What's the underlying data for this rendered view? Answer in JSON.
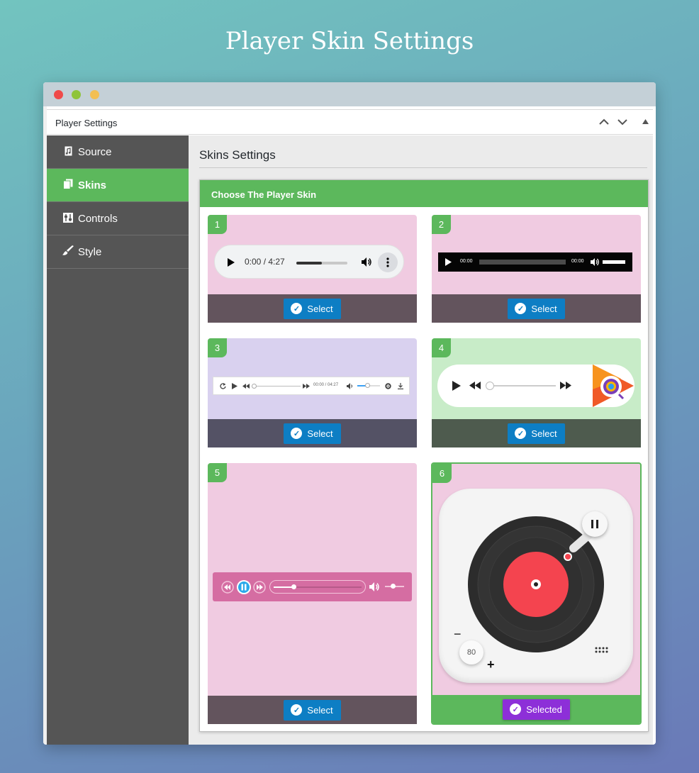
{
  "page": {
    "title": "Player Skin Settings"
  },
  "panel": {
    "title": "Player Settings"
  },
  "sidebar": {
    "items": [
      {
        "label": "Source",
        "icon": "music-file-icon"
      },
      {
        "label": "Skins",
        "icon": "copy-icon"
      },
      {
        "label": "Controls",
        "icon": "sliders-icon"
      },
      {
        "label": "Style",
        "icon": "paint-brush-icon"
      }
    ],
    "active": "Skins"
  },
  "content": {
    "heading": "Skins Settings",
    "box_title": "Choose The Player Skin"
  },
  "skins": [
    {
      "number": "1",
      "button": "Select",
      "time": "0:00 / 4:27"
    },
    {
      "number": "2",
      "button": "Select",
      "time_start": "00:00",
      "time_end": "00:00"
    },
    {
      "number": "3",
      "button": "Select",
      "time": "00:00 / 04:27"
    },
    {
      "number": "4",
      "button": "Select"
    },
    {
      "number": "5",
      "button": "Select"
    },
    {
      "number": "6",
      "button": "Selected",
      "volume": "80",
      "minus": "−",
      "plus": "+"
    }
  ],
  "colors": {
    "accent_green": "#5cb85c",
    "select_blue": "#0d7ec4",
    "selected_purple": "#8d2fd8",
    "sidebar_bg": "#555555"
  }
}
